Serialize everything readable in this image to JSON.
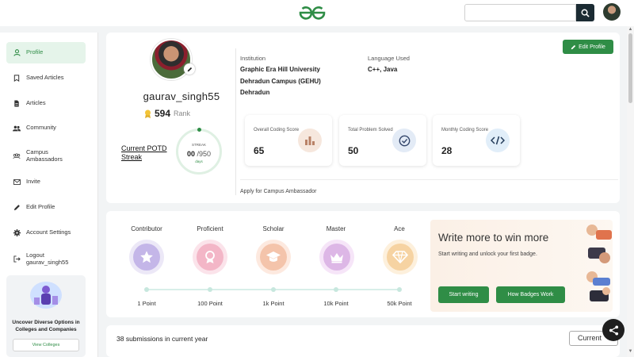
{
  "sidebar": {
    "items": [
      {
        "label": "Profile",
        "icon": "person-icon"
      },
      {
        "label": "Saved Articles",
        "icon": "bookmark-icon"
      },
      {
        "label": "Articles",
        "icon": "document-icon"
      },
      {
        "label": "Community",
        "icon": "community-icon"
      },
      {
        "label": "Campus\nAmbassadors",
        "icon": "group-icon"
      },
      {
        "label": "Invite",
        "icon": "mail-icon"
      },
      {
        "label": "Edit Profile",
        "icon": "pencil-icon"
      },
      {
        "label": "Account Settings",
        "icon": "gear-icon"
      },
      {
        "label": "Logout\ngaurav_singh55",
        "icon": "logout-icon"
      }
    ],
    "promo": {
      "text": "Uncover Diverse Options in Colleges and Companies",
      "button": "View Colleges"
    }
  },
  "profile": {
    "username": "gaurav_singh55",
    "rank_value": "594",
    "rank_label": "Rank",
    "potd_label": "Current POTD Streak",
    "streak": {
      "label": "STREAK",
      "current": "00",
      "total": "/950",
      "unit": "days"
    },
    "institution_label": "Institution",
    "institution_value": "Graphic Era Hill University\nDehradun Campus (GEHU)\nDehradun",
    "language_label": "Language Used",
    "language_value": "C++, Java",
    "edit_button": "Edit Profile",
    "stats": [
      {
        "label": "Overall Coding Score",
        "value": "65",
        "icon": "bar-chart-icon"
      },
      {
        "label": "Total Problem Solved",
        "value": "50",
        "icon": "check-circle-icon"
      },
      {
        "label": "Monthly Coding Score",
        "value": "28",
        "icon": "code-icon"
      }
    ],
    "apply_text": "Apply for Campus Ambassador"
  },
  "badges": {
    "levels": [
      {
        "name": "Contributor",
        "points": "1 Point",
        "icon": "star-icon"
      },
      {
        "name": "Proficient",
        "points": "100 Point",
        "icon": "medal-icon"
      },
      {
        "name": "Scholar",
        "points": "1k Point",
        "icon": "graduation-cap-icon"
      },
      {
        "name": "Master",
        "points": "10k Point",
        "icon": "crown-icon"
      },
      {
        "name": "Ace",
        "points": "50k Point",
        "icon": "diamond-icon"
      }
    ],
    "write_title": "Write more to win more",
    "write_subtitle": "Start writing and unlock your first badge.",
    "start_button": "Start writing",
    "how_button": "How Badges Work"
  },
  "submissions": {
    "text": "38 submissions in current year",
    "selector": "Current"
  },
  "colors": {
    "brand_green": "#2f8d46",
    "dark": "#1b2b33"
  }
}
